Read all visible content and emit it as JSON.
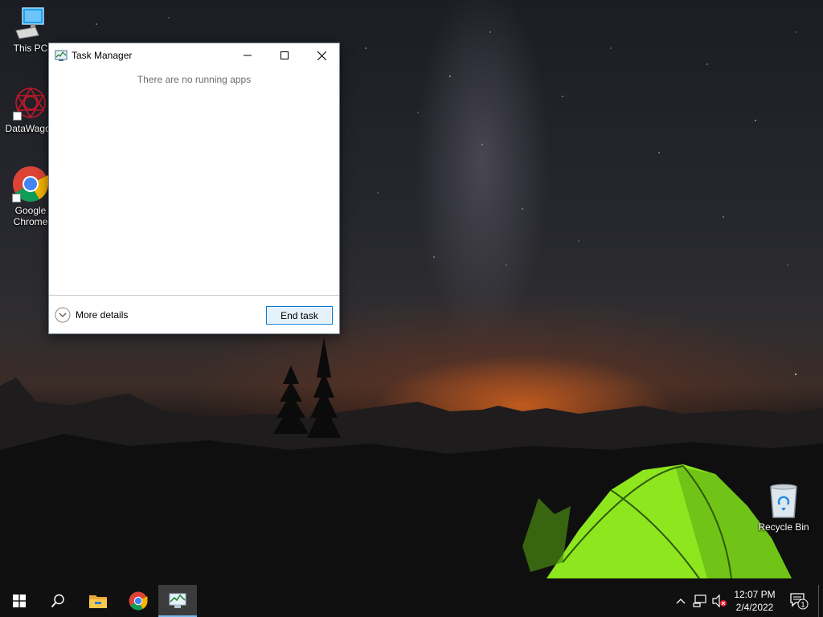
{
  "desktop": {
    "icons": [
      {
        "label": "This PC",
        "icon": "computer-icon"
      },
      {
        "label": "DataWagon",
        "icon": "datawagon-logo-icon"
      },
      {
        "label": "Google\nChrome",
        "icon": "chrome-icon"
      },
      {
        "label": "Recycle Bin",
        "icon": "recycle-bin-icon"
      }
    ]
  },
  "task_manager": {
    "title": "Task Manager",
    "empty_message": "There are no running apps",
    "more_details_label": "More details",
    "end_task_label": "End task",
    "controls": [
      "minimize-icon",
      "maximize-icon",
      "close-icon"
    ]
  },
  "taskbar": {
    "pinned": [
      "windows-start-icon",
      "search-icon",
      "file-explorer-icon",
      "chrome-icon",
      "task-manager-icon"
    ],
    "active": "task-manager-icon",
    "tray": [
      "chevron-up-icon",
      "network-icon",
      "volume-muted-icon"
    ],
    "clock": {
      "time": "12:07 PM",
      "date": "2/4/2022"
    },
    "notifications": {
      "icon": "action-center-icon",
      "count": "1"
    }
  },
  "colors": {
    "accent": "#0078d7",
    "taskbar": "#101010",
    "tent_green": "#8ee61f"
  }
}
